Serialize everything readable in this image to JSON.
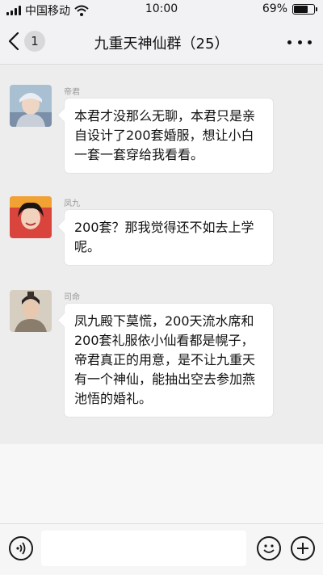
{
  "status_bar": {
    "carrier": "中国移动",
    "time": "10:00",
    "battery_percent": "69%",
    "battery_level": 0.69
  },
  "nav": {
    "back_badge": "1",
    "title": "九重天神仙群（25）"
  },
  "messages": [
    {
      "sender": "帝君",
      "text": "本君才没那么无聊，本君只是亲自设计了200套婚服，想让小白一套一套穿给我看看。"
    },
    {
      "sender": "凤九",
      "text": "200套？那我觉得还不如去上学呢。"
    },
    {
      "sender": "司命",
      "text": "凤九殿下莫慌，200天流水席和200套礼服依小仙看都是幌子，帝君真正的用意，是不让九重天有一个神仙，能抽出空去参加燕池悟的婚礼。"
    }
  ],
  "input": {
    "value": "",
    "placeholder": ""
  },
  "icons": {
    "voice": "voice-icon",
    "emoji": "emoji-icon",
    "add": "plus-icon",
    "back": "chevron-left-icon",
    "more": "more-dots-icon"
  }
}
